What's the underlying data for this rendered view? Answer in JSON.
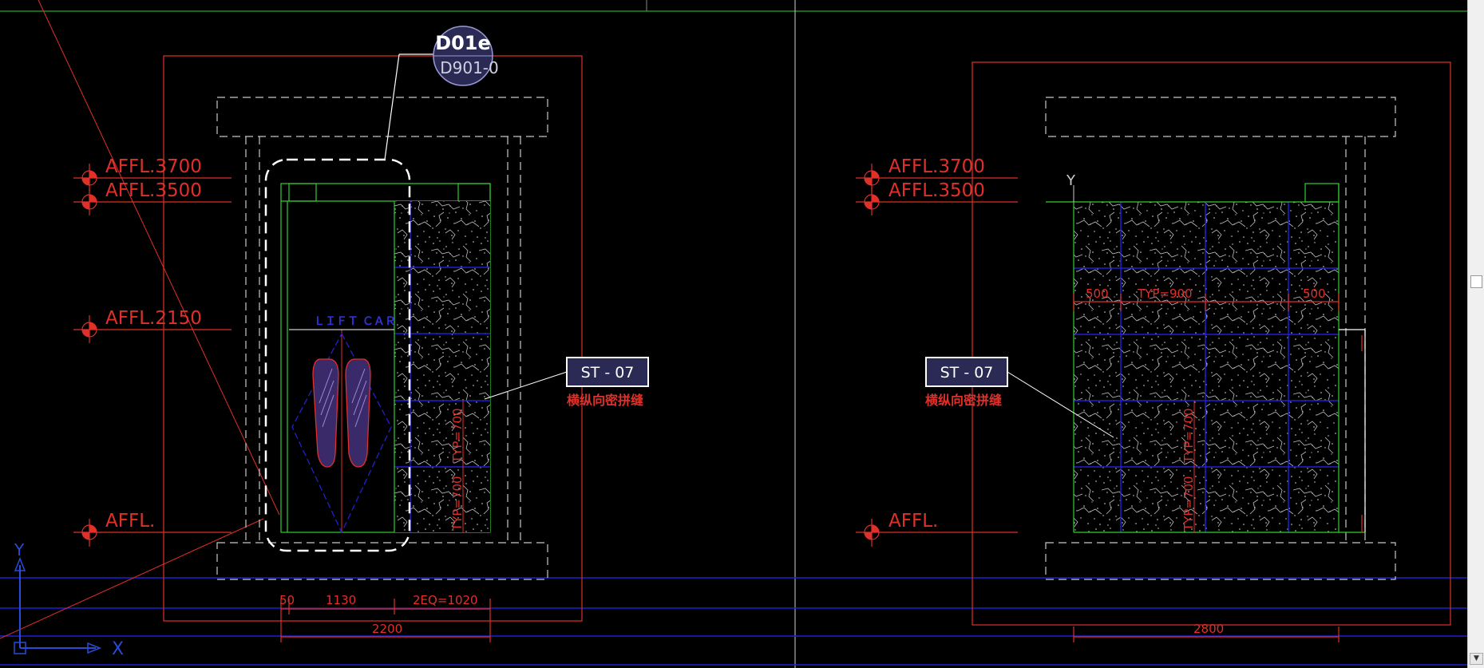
{
  "colors": {
    "background": "#000000",
    "outline_red": "#e0302a",
    "grid_blue": "#2020d0",
    "green": "#33cc33",
    "tag_fill": "#2a2a55"
  },
  "view_left": {
    "section_tag": {
      "code": "D01e",
      "ref": "D901-0"
    },
    "levels": [
      "AFFL.3700",
      "AFFL.3500",
      "AFFL.2150",
      "AFFL."
    ],
    "door_label": "ＬＩＦＴ ＣＡＲ",
    "material_tag": {
      "code": "ST - 07",
      "note": "横纵向密拼缝"
    },
    "dim_vertical": "TYP=700",
    "dims_bottom": [
      "50",
      "1130",
      "2EQ=1020",
      "2200"
    ]
  },
  "view_right": {
    "levels": [
      "AFFL.3700",
      "AFFL.3500",
      "AFFL."
    ],
    "material_tag": {
      "code": "ST - 07",
      "note": "横纵向密拼缝"
    },
    "dims_top": [
      "500",
      "TYP=900",
      "500"
    ],
    "dim_vertical": "TYP=700",
    "dim_bottom": "2800"
  },
  "ucs": {
    "x_label": "X",
    "y_label": "Y"
  },
  "ucs_right_y": "Y",
  "scrollbar": {
    "up": "▲",
    "down": "▼"
  }
}
